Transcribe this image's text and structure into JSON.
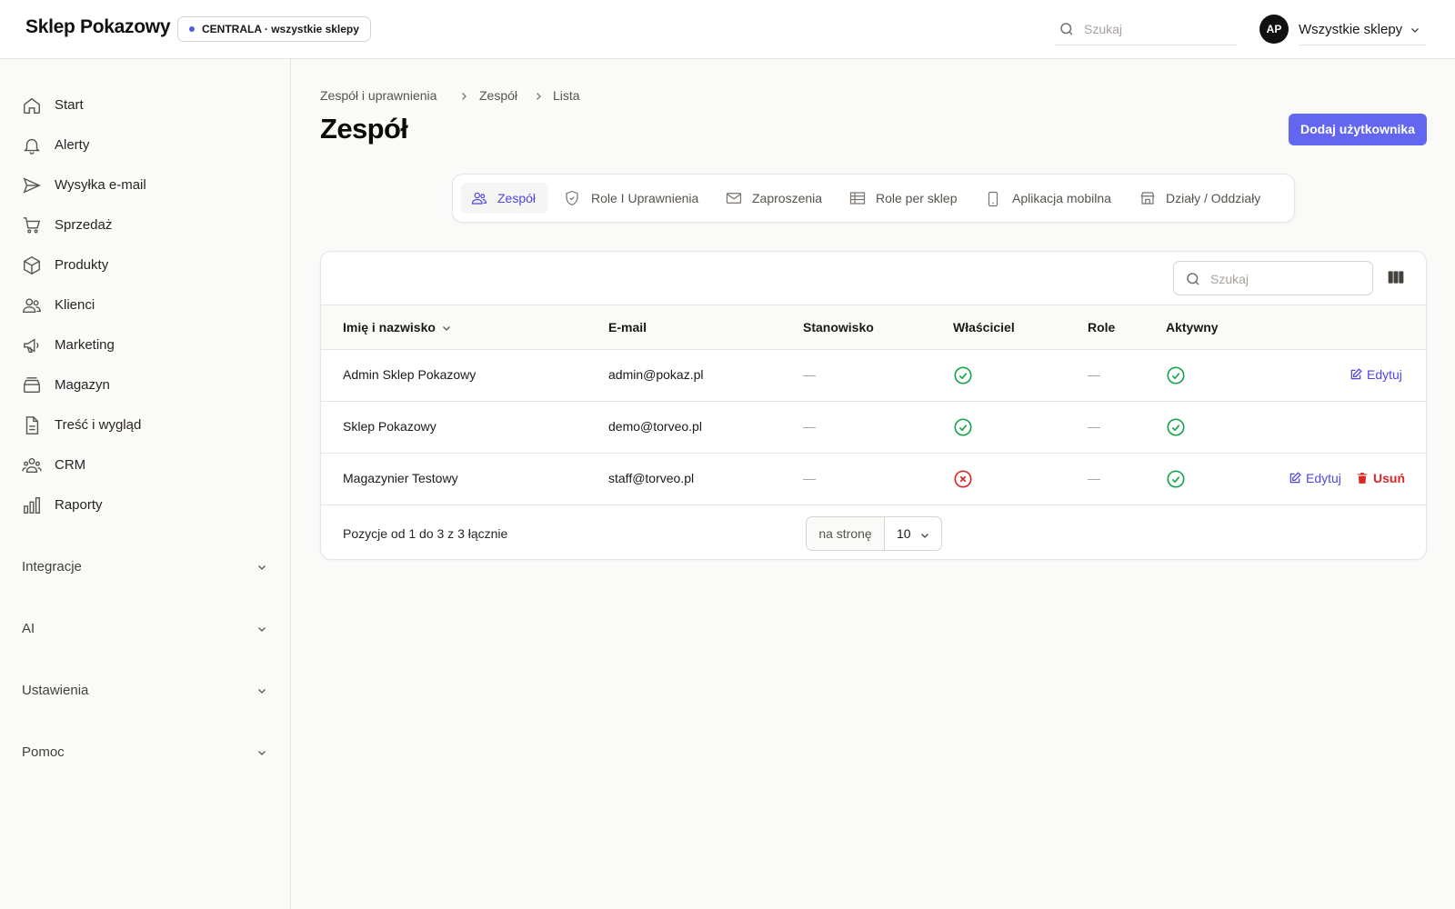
{
  "header": {
    "brand": "Sklep Pokazowy",
    "store_badge": "CENTRALA · wszystkie sklepy",
    "search_placeholder": "Szukaj",
    "avatar_initials": "AP",
    "store_select": "Wszystkie sklepy",
    "accent_color": "#6366f1"
  },
  "sidebar": {
    "items": [
      {
        "label": "Start",
        "icon": "home-icon"
      },
      {
        "label": "Alerty",
        "icon": "bell-icon"
      },
      {
        "label": "Wysyłka e-mail",
        "icon": "send-icon"
      },
      {
        "label": "Sprzedaż",
        "icon": "cart-icon"
      },
      {
        "label": "Produkty",
        "icon": "box-icon"
      },
      {
        "label": "Klienci",
        "icon": "users-icon"
      },
      {
        "label": "Marketing",
        "icon": "megaphone-icon"
      },
      {
        "label": "Magazyn",
        "icon": "archive-icon"
      },
      {
        "label": "Treść i wygląd",
        "icon": "document-icon"
      },
      {
        "label": "CRM",
        "icon": "group-icon"
      },
      {
        "label": "Raporty",
        "icon": "bar-chart-icon"
      }
    ],
    "groups": [
      {
        "label": "Integracje"
      },
      {
        "label": "AI"
      },
      {
        "label": "Ustawienia"
      },
      {
        "label": "Pomoc"
      }
    ]
  },
  "breadcrumb": [
    "Zespół i uprawnienia",
    "Zespół",
    "Lista"
  ],
  "page_title": "Zespół",
  "add_button": "Dodaj użytkownika",
  "tabs": [
    {
      "label": "Zespół",
      "icon": "users-icon",
      "active": true
    },
    {
      "label": "Role I Uprawnienia",
      "icon": "shield-icon"
    },
    {
      "label": "Zaproszenia",
      "icon": "envelope-icon"
    },
    {
      "label": "Role per sklep",
      "icon": "table-icon"
    },
    {
      "label": "Aplikacja mobilna",
      "icon": "phone-icon"
    },
    {
      "label": "Działy / Oddziały",
      "icon": "store-icon"
    }
  ],
  "table": {
    "search_placeholder": "Szukaj",
    "columns": [
      "Imię i nazwisko",
      "E-mail",
      "Stanowisko",
      "Właściciel",
      "Role",
      "Aktywny"
    ],
    "rows": [
      {
        "name": "Admin Sklep Pokazowy",
        "email": "admin@pokaz.pl",
        "position": "—",
        "owner": true,
        "roles": "—",
        "active": true,
        "actions": [
          "Edytuj"
        ]
      },
      {
        "name": "Sklep Pokazowy",
        "email": "demo@torveo.pl",
        "position": "—",
        "owner": true,
        "roles": "—",
        "active": true,
        "actions": []
      },
      {
        "name": "Magazynier Testowy",
        "email": "staff@torveo.pl",
        "position": "—",
        "owner": false,
        "roles": "—",
        "active": true,
        "actions": [
          "Edytuj",
          "Usuń"
        ]
      }
    ],
    "footer_info": "Pozycje od 1 do 3 z 3 łącznie",
    "per_page_label": "na stronę",
    "per_page_value": "10"
  },
  "colors": {
    "success": "#16a34a",
    "danger": "#dc2626",
    "link": "#4f46e5"
  }
}
